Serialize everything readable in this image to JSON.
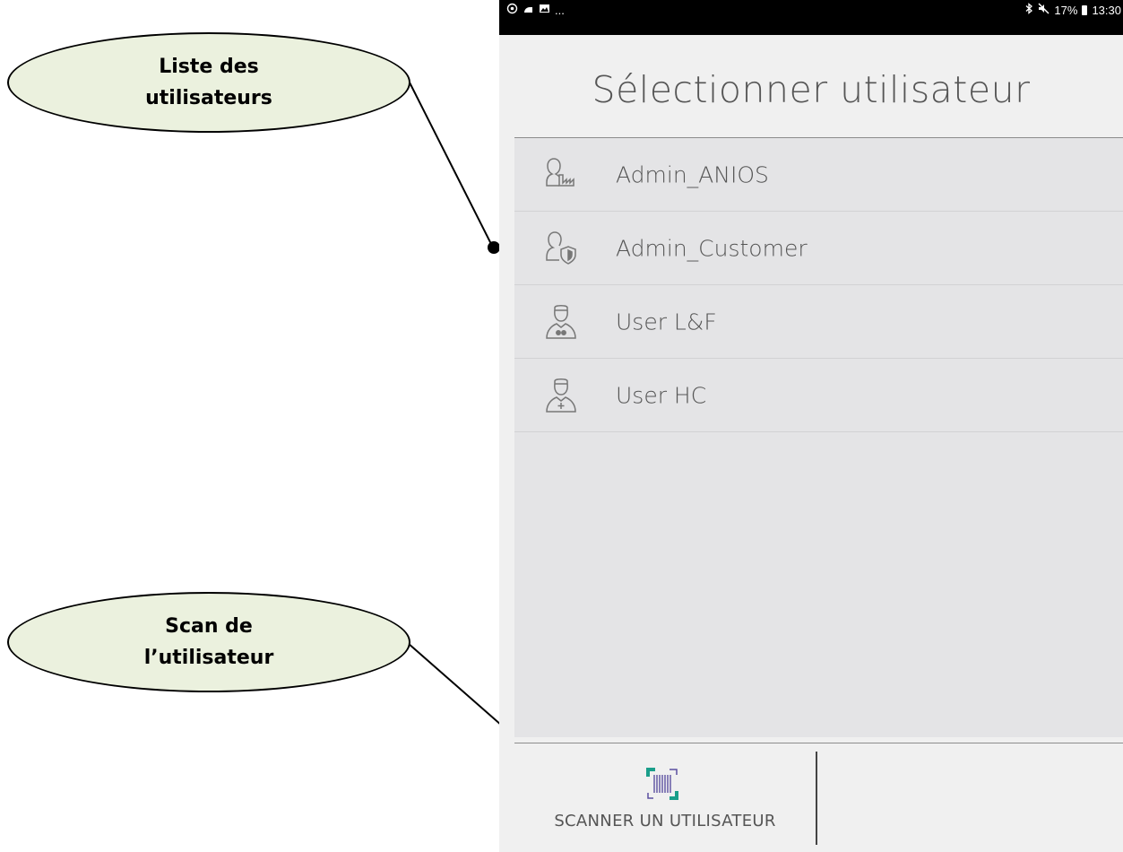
{
  "status_bar": {
    "left_icons": [
      "whatsapp-icon",
      "cast-icon",
      "gallery-icon"
    ],
    "left_more": "...",
    "bluetooth_icon": "bluetooth-icon",
    "mute_icon": "mute-icon",
    "battery": "17%",
    "time": "13:30"
  },
  "screen": {
    "title": "Sélectionner utilisateur",
    "users": [
      {
        "name": "Admin_ANIOS",
        "icon": "admin-factory-icon"
      },
      {
        "name": "Admin_Customer",
        "icon": "admin-shield-icon"
      },
      {
        "name": "User L&F",
        "icon": "user-nurse-pills-icon"
      },
      {
        "name": "User HC",
        "icon": "user-nurse-cross-icon"
      }
    ],
    "scan_button_label": "SCANNER UN UTILISATEUR"
  },
  "annotations": {
    "user_list": [
      "Liste des",
      "utilisateurs"
    ],
    "scan": [
      "Scan de",
      "l’utilisateur"
    ]
  },
  "colors": {
    "callout_fill": "#ebf1de",
    "list_bg": "#e4e4e6",
    "screen_bg": "#f0f0f0",
    "barcode_teal": "#1a9e8a",
    "barcode_purple": "#5b4fa0"
  }
}
